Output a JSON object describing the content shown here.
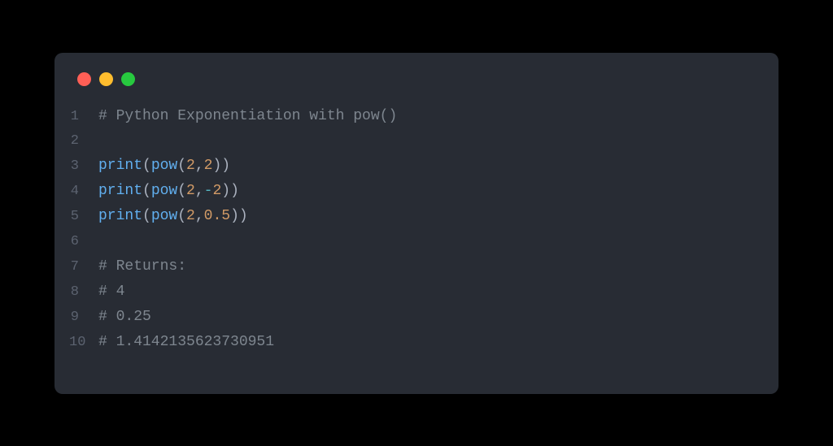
{
  "window": {
    "controls": [
      "close",
      "minimize",
      "zoom"
    ]
  },
  "code": {
    "lines": [
      {
        "num": "1",
        "tokens": [
          {
            "t": "# Python Exponentiation with pow()",
            "c": "comment"
          }
        ]
      },
      {
        "num": "2",
        "tokens": []
      },
      {
        "num": "3",
        "tokens": [
          {
            "t": "print",
            "c": "builtin"
          },
          {
            "t": "(",
            "c": "punc"
          },
          {
            "t": "pow",
            "c": "builtin"
          },
          {
            "t": "(",
            "c": "punc"
          },
          {
            "t": "2",
            "c": "number"
          },
          {
            "t": ",",
            "c": "punc"
          },
          {
            "t": "2",
            "c": "number"
          },
          {
            "t": "))",
            "c": "punc"
          }
        ]
      },
      {
        "num": "4",
        "tokens": [
          {
            "t": "print",
            "c": "builtin"
          },
          {
            "t": "(",
            "c": "punc"
          },
          {
            "t": "pow",
            "c": "builtin"
          },
          {
            "t": "(",
            "c": "punc"
          },
          {
            "t": "2",
            "c": "number"
          },
          {
            "t": ",",
            "c": "punc"
          },
          {
            "t": "-",
            "c": "op"
          },
          {
            "t": "2",
            "c": "number"
          },
          {
            "t": "))",
            "c": "punc"
          }
        ]
      },
      {
        "num": "5",
        "tokens": [
          {
            "t": "print",
            "c": "builtin"
          },
          {
            "t": "(",
            "c": "punc"
          },
          {
            "t": "pow",
            "c": "builtin"
          },
          {
            "t": "(",
            "c": "punc"
          },
          {
            "t": "2",
            "c": "number"
          },
          {
            "t": ",",
            "c": "punc"
          },
          {
            "t": "0.5",
            "c": "number"
          },
          {
            "t": "))",
            "c": "punc"
          }
        ]
      },
      {
        "num": "6",
        "tokens": []
      },
      {
        "num": "7",
        "tokens": [
          {
            "t": "# Returns:",
            "c": "comment"
          }
        ]
      },
      {
        "num": "8",
        "tokens": [
          {
            "t": "# 4",
            "c": "comment"
          }
        ]
      },
      {
        "num": "9",
        "tokens": [
          {
            "t": "# 0.25",
            "c": "comment"
          }
        ]
      },
      {
        "num": "10",
        "tokens": [
          {
            "t": "# 1.4142135623730951",
            "c": "comment"
          }
        ]
      }
    ]
  }
}
